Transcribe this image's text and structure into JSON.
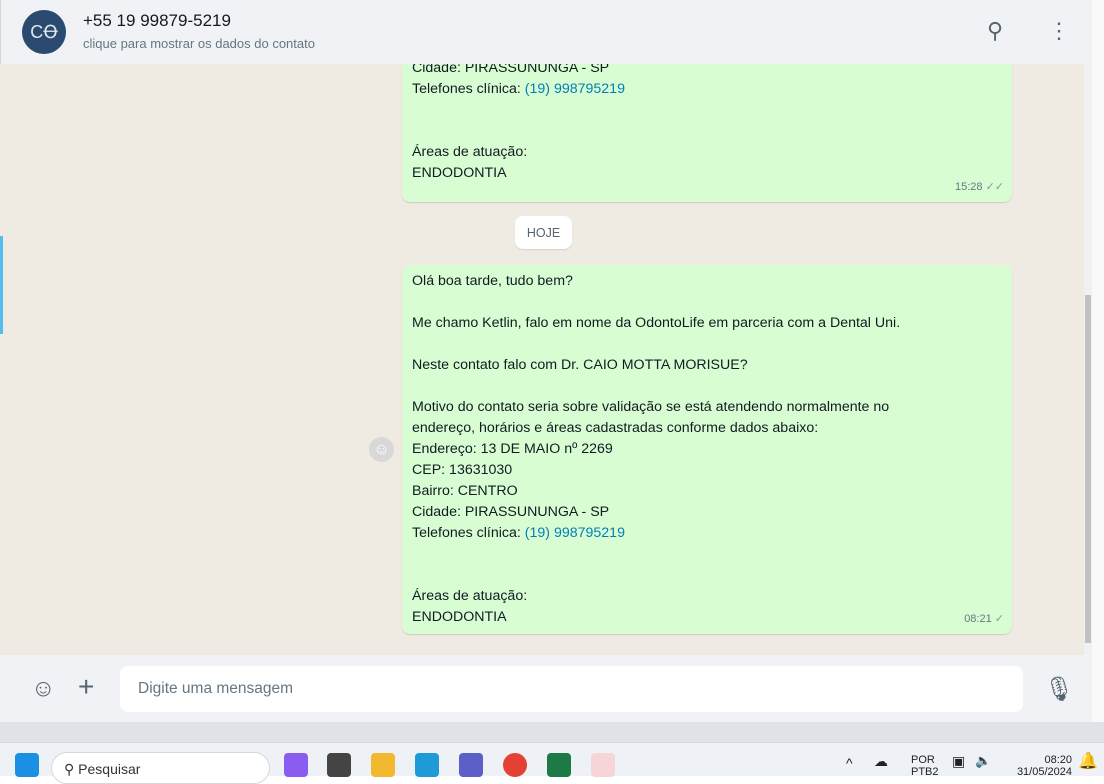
{
  "header": {
    "title": "+55 19 99879-5219",
    "subtitle": "clique para mostrar os dados do contato",
    "avatar_text": "CꝊ"
  },
  "messages": [
    {
      "lines": [
        "Cidade: PIRASSUNUNGA - SP"
      ],
      "phone_label": "Telefones clínica: ",
      "phone": "(19) 998795219",
      "tail": [
        "",
        "",
        "Áreas de atuação:",
        "ENDODONTIA"
      ],
      "time": "15:28",
      "ticks": "✓✓"
    },
    {
      "lines": [
        "Olá boa tarde, tudo bem?",
        "",
        "Me chamo Ketlin, falo em nome da OdontoLife em parceria com a Dental Uni.",
        "",
        "Neste contato falo com Dr. CAIO MOTTA MORISUE?",
        "",
        "Motivo do contato seria sobre validação se está atendendo normalmente no",
        "endereço, horários e áreas cadastradas conforme dados abaixo:",
        "Endereço: 13 DE MAIO nº 2269",
        "CEP: 13631030",
        "Bairro: CENTRO",
        "Cidade: PIRASSUNUNGA - SP"
      ],
      "phone_label": "Telefones clínica: ",
      "phone": "(19) 998795219",
      "tail": [
        "",
        "",
        "Áreas de atuação:",
        "ENDODONTIA"
      ],
      "time": "08:21",
      "ticks": "✓"
    }
  ],
  "date_divider": "HOJE",
  "composer": {
    "placeholder": "Digite uma mensagem"
  },
  "taskbar": {
    "search": "Pesquisar",
    "lang1": "POR",
    "lang2": "PTB2",
    "time": "08:20",
    "date": "31/05/2024"
  }
}
